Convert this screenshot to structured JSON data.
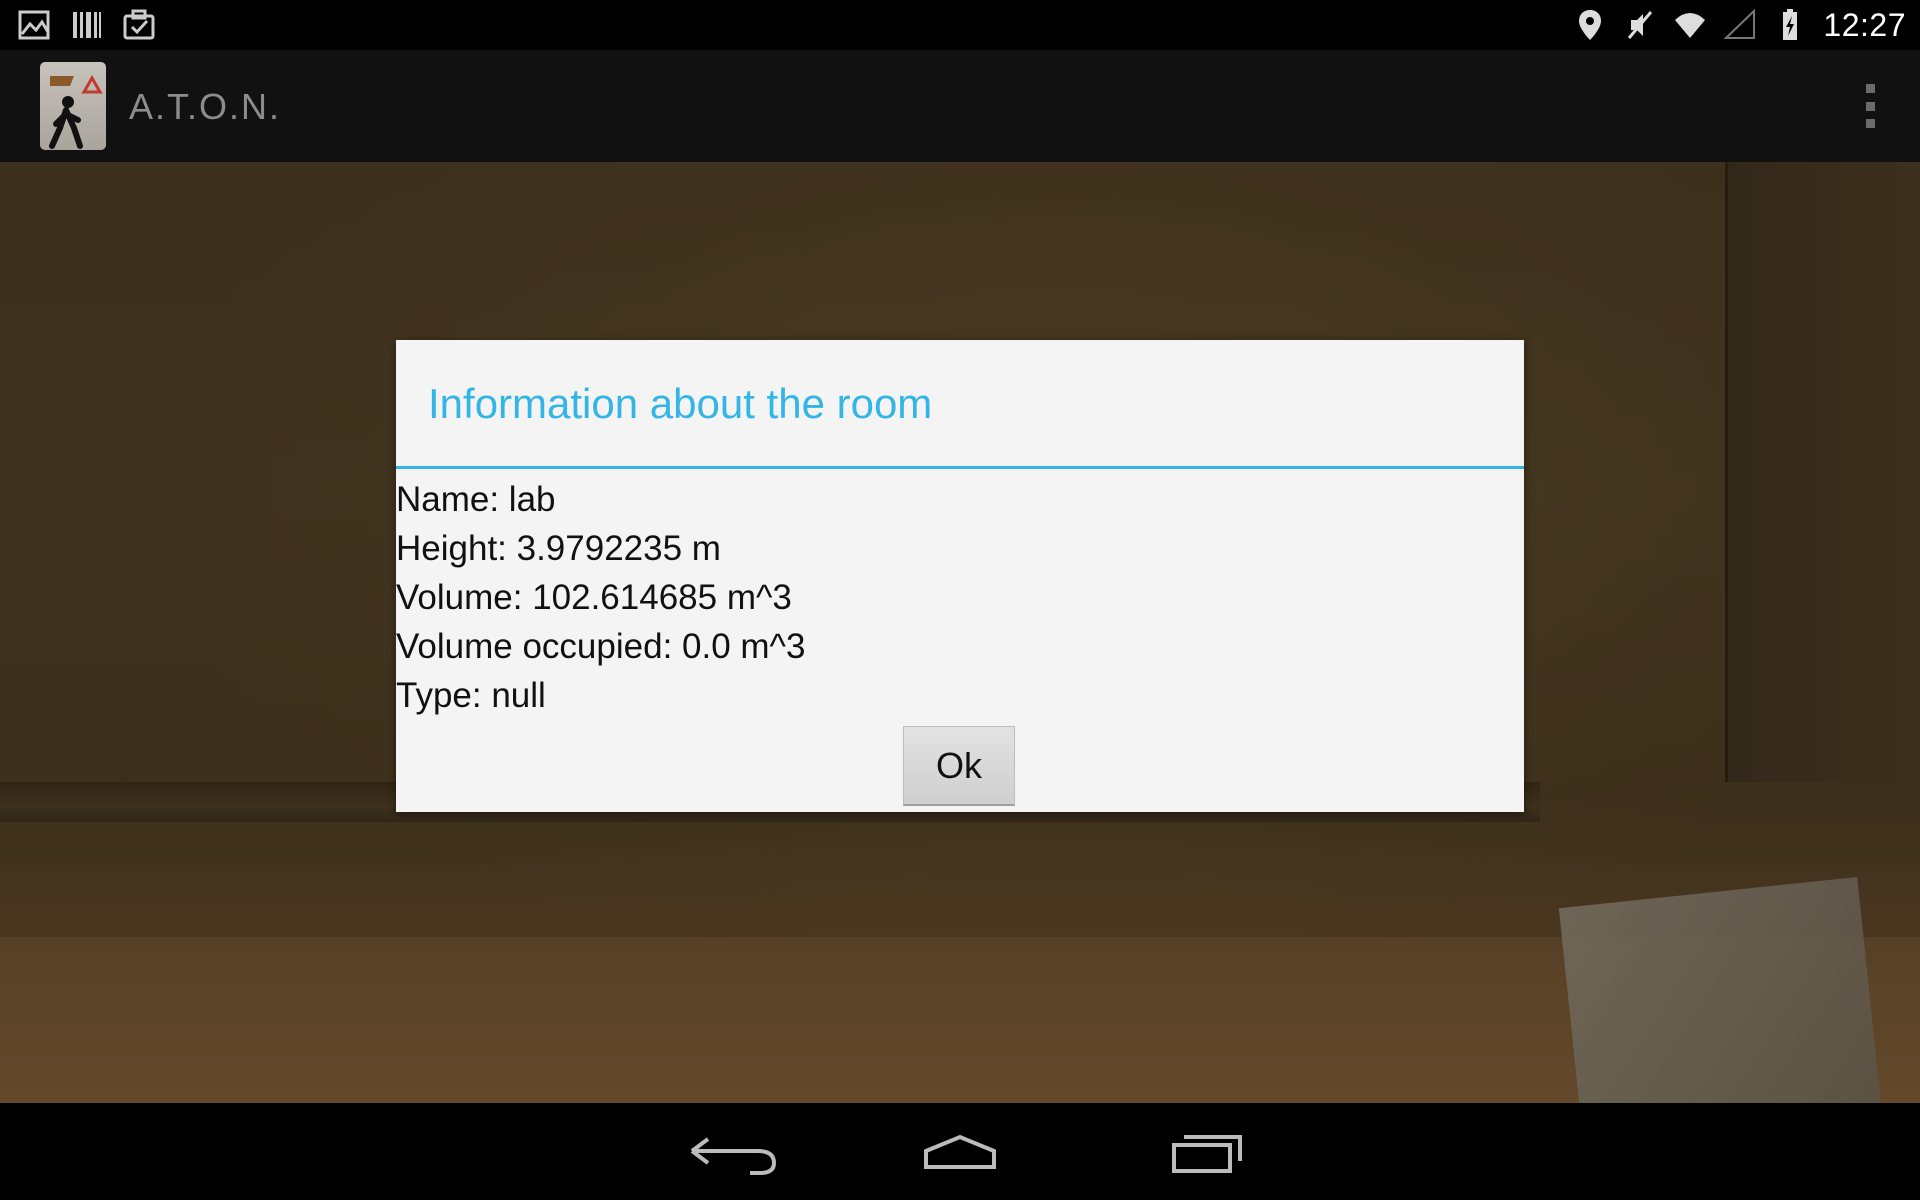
{
  "status_bar": {
    "left_icons": [
      "gallery-icon",
      "barcode-icon",
      "clipboard-check-icon"
    ],
    "right_icons": [
      "location-icon",
      "mute-icon",
      "wifi-icon",
      "signal-icon",
      "battery-charging-icon"
    ],
    "time": "12:27"
  },
  "action_bar": {
    "app_title": "A.T.O.N.",
    "overflow_icon": "overflow-menu-icon"
  },
  "dialog": {
    "title": "Information about the room",
    "lines": [
      "Name: lab",
      "Height: 3.9792235 m",
      "Volume: 102.614685 m^3",
      "Volume occupied: 0.0 m^3",
      "Type: null"
    ],
    "ok_label": "Ok",
    "accent_color": "#33b5e5"
  },
  "nav_bar": {
    "buttons": [
      "back-icon",
      "home-icon",
      "recent-apps-icon"
    ]
  }
}
